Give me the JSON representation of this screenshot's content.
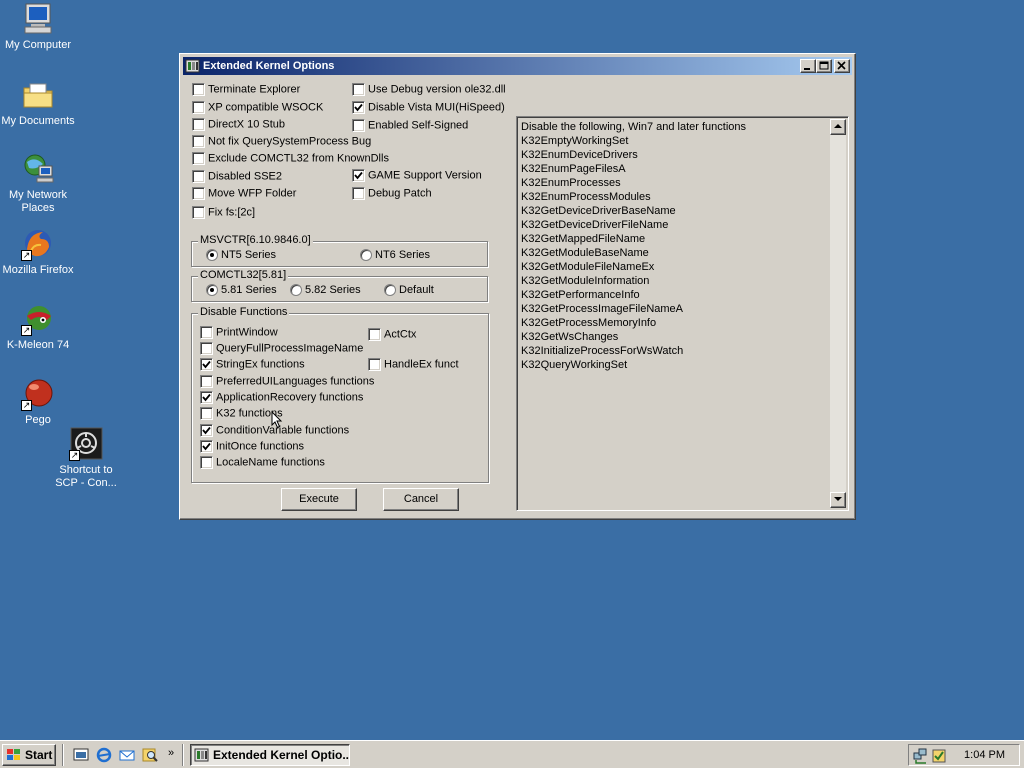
{
  "desktop": {
    "icons": [
      {
        "label": "My Computer",
        "icon": "computer-icon"
      },
      {
        "label": "My Documents",
        "icon": "folder-documents-icon"
      },
      {
        "label": "My Network Places",
        "icon": "network-places-icon"
      },
      {
        "label": "Mozilla Firefox",
        "icon": "firefox-icon"
      },
      {
        "label": "K-Meleon 74",
        "icon": "k-meleon-icon"
      },
      {
        "label": "Pego",
        "icon": "pego-icon"
      },
      {
        "label": "Shortcut to SCP - Con...",
        "icon": "scp-shortcut-icon"
      }
    ]
  },
  "window": {
    "title": "Extended Kernel Options",
    "left_options": [
      {
        "label": "Terminate Explorer",
        "checked": false
      },
      {
        "label": "XP compatible WSOCK",
        "checked": false
      },
      {
        "label": "DirectX 10 Stub",
        "checked": false
      },
      {
        "label": "Not fix QuerySystemProcess Bug",
        "checked": false
      },
      {
        "label": "Exclude COMCTL32 from KnownDlls",
        "checked": false
      },
      {
        "label": "Disabled SSE2",
        "checked": false
      },
      {
        "label": "Move WFP Folder",
        "checked": false
      },
      {
        "label": "Fix fs:[2c]",
        "checked": false
      }
    ],
    "right_options": [
      {
        "label": "Use Debug version ole32.dll",
        "checked": false
      },
      {
        "label": "Disable Vista MUI(HiSpeed)",
        "checked": true
      },
      {
        "label": "Enabled Self-Signed",
        "checked": false
      },
      {
        "label": "GAME Support Version",
        "checked": true
      },
      {
        "label": "Debug Patch",
        "checked": false
      }
    ],
    "msvcrt": {
      "title": "MSVCTR[6.10.9846.0]",
      "options": [
        {
          "label": "NT5 Series",
          "selected": true
        },
        {
          "label": "NT6 Series",
          "selected": false
        }
      ]
    },
    "comctl32": {
      "title": "COMCTL32[5.81]",
      "options": [
        {
          "label": "5.81 Series",
          "selected": true
        },
        {
          "label": "5.82 Series",
          "selected": false
        },
        {
          "label": "Default",
          "selected": false
        }
      ]
    },
    "disable_functions": {
      "title": "Disable Functions",
      "items": [
        {
          "label": "PrintWindow",
          "checked": false
        },
        {
          "label": "ActCtx",
          "checked": false
        },
        {
          "label": "QueryFullProcessImageName",
          "checked": false
        },
        {
          "label": "StringEx functions",
          "checked": true
        },
        {
          "label": "HandleEx funct",
          "checked": false
        },
        {
          "label": "PreferredUILanguages functions",
          "checked": false
        },
        {
          "label": "ApplicationRecovery functions",
          "checked": true
        },
        {
          "label": "K32 functions",
          "checked": false
        },
        {
          "label": "ConditionVariable functions",
          "checked": true
        },
        {
          "label": "InitOnce functions",
          "checked": true
        },
        {
          "label": "LocaleName functions",
          "checked": false
        }
      ]
    },
    "buttons": {
      "execute": "Execute",
      "cancel": "Cancel"
    },
    "info_lines": [
      "Disable the following, Win7 and later functions",
      "K32EmptyWorkingSet",
      "K32EnumDeviceDrivers",
      "K32EnumPageFilesA",
      "K32EnumProcesses",
      "K32EnumProcessModules",
      "K32GetDeviceDriverBaseName",
      "K32GetDeviceDriverFileName",
      "K32GetMappedFileName",
      "K32GetModuleBaseName",
      "K32GetModuleFileNameEx",
      "K32GetModuleInformation",
      "K32GetPerformanceInfo",
      "K32GetProcessImageFileNameA",
      "K32GetProcessMemoryInfo",
      "K32GetWsChanges",
      "K32InitializeProcessForWsWatch",
      "K32QueryWorkingSet"
    ]
  },
  "taskbar": {
    "start_label": "Start",
    "task_label": "Extended Kernel Optio...",
    "clock": "1:04 PM"
  },
  "colors": {
    "desktop": "#3a6ea5",
    "titlebar_start": "#0a246a",
    "titlebar_end": "#a6caf0",
    "face": "#d4d0c8"
  }
}
